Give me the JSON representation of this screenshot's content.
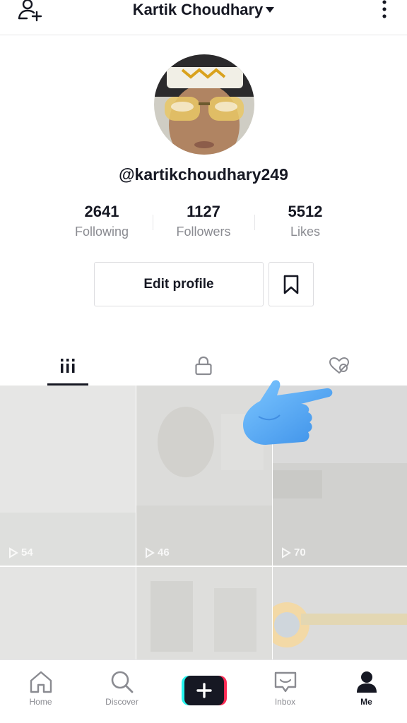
{
  "header": {
    "title": "Kartik Choudhary"
  },
  "profile": {
    "handle": "@kartikchoudhary249"
  },
  "stats": [
    {
      "value": "2641",
      "label": "Following"
    },
    {
      "value": "1127",
      "label": "Followers"
    },
    {
      "value": "5512",
      "label": "Likes"
    }
  ],
  "actions": {
    "edit_label": "Edit profile"
  },
  "tabs": [
    {
      "icon": "grid-icon",
      "active": true
    },
    {
      "icon": "lock-icon",
      "active": false
    },
    {
      "icon": "liked-hidden-icon",
      "active": false
    }
  ],
  "videos": [
    {
      "views": "54"
    },
    {
      "views": "46"
    },
    {
      "views": "70"
    }
  ],
  "nav": {
    "home": "Home",
    "discover": "Discover",
    "inbox": "Inbox",
    "me": "Me"
  }
}
